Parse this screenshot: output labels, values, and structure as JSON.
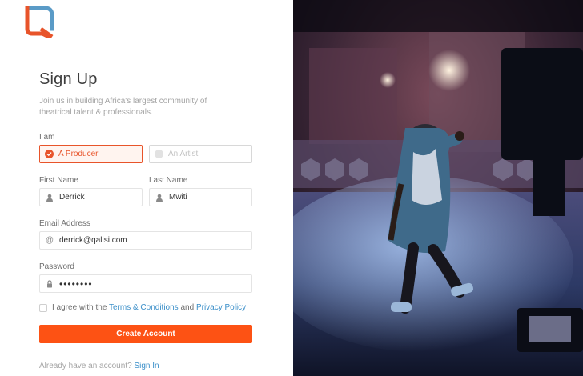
{
  "brand": {
    "accent": "#fd5214",
    "logo_colors": [
      "#e8542a",
      "#5a9bc7"
    ]
  },
  "header": {
    "title": "Sign Up",
    "subtitle": "Join us in building Africa's largest community of theatrical talent & professionals."
  },
  "role": {
    "label": "I am",
    "options": [
      {
        "label": "A Producer",
        "selected": true
      },
      {
        "label": "An Artist",
        "selected": false
      }
    ]
  },
  "form": {
    "first_name": {
      "label": "First Name",
      "value": "Derrick",
      "icon": "user-icon"
    },
    "last_name": {
      "label": "Last Name",
      "value": "Mwiti",
      "icon": "user-icon"
    },
    "email": {
      "label": "Email Address",
      "value": "derrick@qalisi.com",
      "icon": "at-icon",
      "icon_glyph": "@"
    },
    "password": {
      "label": "Password",
      "value": "••••••••",
      "icon": "lock-icon"
    }
  },
  "terms": {
    "prefix": "I agree with the",
    "terms_link": "Terms & Conditions",
    "and": "and",
    "privacy_link": "Privacy Policy",
    "checked": false
  },
  "actions": {
    "create_label": "Create Account"
  },
  "footer": {
    "prompt": "Already have an account?",
    "signin_link": "Sign In"
  }
}
